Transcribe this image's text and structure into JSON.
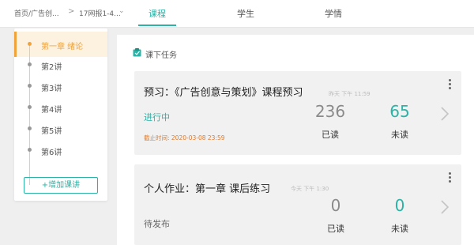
{
  "breadcrumb": {
    "path": "首页/广告创...",
    "course": "17网报1-4..."
  },
  "tabs": [
    {
      "label": "课程",
      "active": true
    },
    {
      "label": "学生",
      "active": false
    },
    {
      "label": "学情",
      "active": false
    }
  ],
  "sidebar": {
    "items": [
      {
        "label": "第一章 绪论",
        "active": true
      },
      {
        "label": "第2讲",
        "active": false
      },
      {
        "label": "第3讲",
        "active": false
      },
      {
        "label": "第4讲",
        "active": false
      },
      {
        "label": "第5讲",
        "active": false
      },
      {
        "label": "第6讲",
        "active": false
      }
    ],
    "add_label": "+增加课讲"
  },
  "section": {
    "title": "课下任务",
    "icon": "clipboard-icon"
  },
  "cards": [
    {
      "title": "预习：《广告创意与策划》课程预习",
      "time": "昨天 下午 11:59",
      "status": "进行中",
      "status_color": "#2ab3a6",
      "deadline": "截止时间: 2020-03-08 23:59",
      "read_count": "236",
      "read_label": "已读",
      "unread_count": "65",
      "unread_label": "未读"
    },
    {
      "title": "个人作业：第一章 课后练习",
      "time": "今天 下午 1:30",
      "status": "待发布",
      "status_color": "#666666",
      "read_count": "0",
      "read_label": "已读",
      "unread_count": "0",
      "unread_label": "未读"
    }
  ],
  "colors": {
    "accent": "#2ab3a6",
    "active_chapter": "#f0a33a",
    "deadline": "#e07a2c"
  }
}
